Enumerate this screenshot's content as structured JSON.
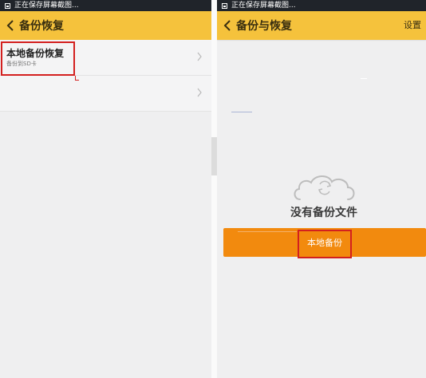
{
  "left": {
    "status_text": "正在保存屏幕截图...",
    "title": "备份恢复",
    "items": [
      {
        "title": "本地备份恢复",
        "subtitle": "备份到SD卡"
      },
      {
        "title": "",
        "subtitle": ""
      }
    ]
  },
  "right": {
    "status_text": "正在保存屏幕截图...",
    "title": "备份与恢复",
    "settings_label": "设置",
    "empty_text": "没有备份文件",
    "backup_button_label": "本地备份"
  },
  "colors": {
    "title_bar": "#f5c23c",
    "status_bar": "#20242a",
    "button": "#f28a0e",
    "highlight": "#d3201f",
    "background": "#efeff0"
  }
}
